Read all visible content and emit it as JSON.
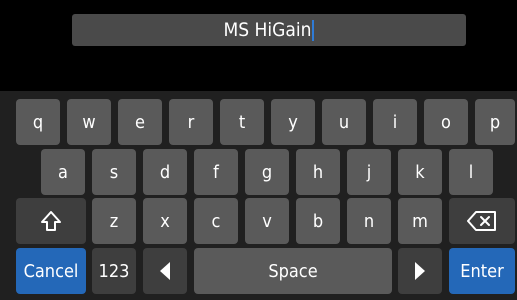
{
  "name_field": {
    "value": "MS HiGain"
  },
  "keyboard": {
    "row1": [
      "q",
      "w",
      "e",
      "r",
      "t",
      "y",
      "u",
      "i",
      "o",
      "p"
    ],
    "row2": [
      "a",
      "s",
      "d",
      "f",
      "g",
      "h",
      "j",
      "k",
      "l"
    ],
    "row3": [
      "z",
      "x",
      "c",
      "v",
      "b",
      "n",
      "m"
    ],
    "cancel_label": "Cancel",
    "numbers_label": "123",
    "space_label": "Space",
    "enter_label": "Enter",
    "icons": {
      "shift": "shift-arrow-icon",
      "backspace": "backspace-icon",
      "cursor_left": "triangle-left-icon",
      "cursor_right": "triangle-right-icon"
    }
  },
  "colors": {
    "key": "#5a5a5a",
    "key_dark": "#3e3e3e",
    "accent": "#2468b8",
    "caret": "#2f7bd6"
  }
}
